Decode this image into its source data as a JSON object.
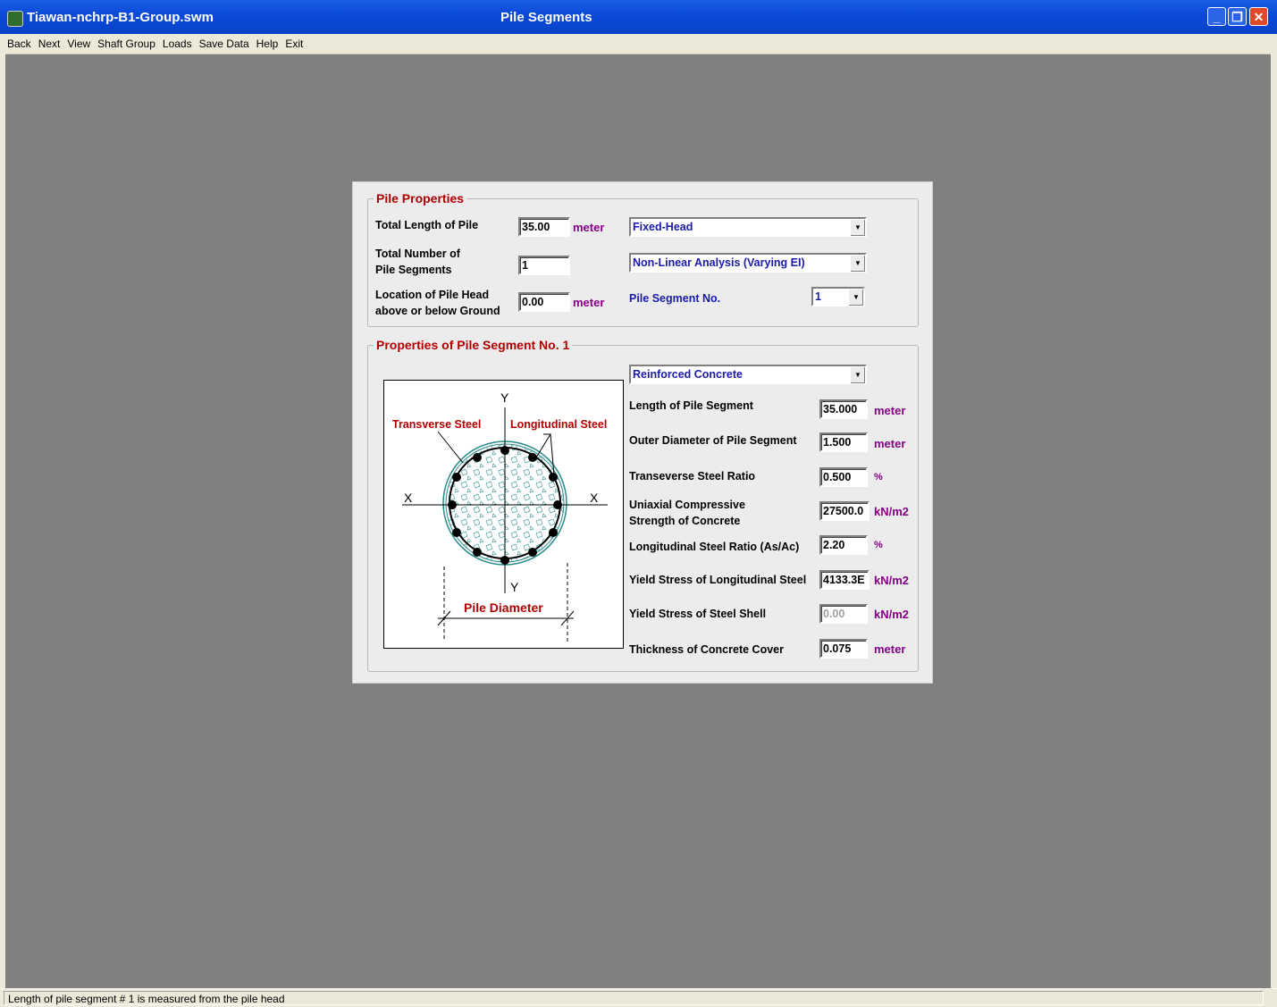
{
  "window": {
    "file_title": "Tiawan-nchrp-B1-Group.swm",
    "screen_title": "Pile Segments",
    "minimize": "_",
    "restore": "❐",
    "close": "✕"
  },
  "menu": [
    "Back",
    "Next",
    "View",
    "Shaft Group",
    "Loads",
    "Save Data",
    "Help",
    "Exit"
  ],
  "pile_properties": {
    "title": "Pile Properties",
    "total_length_label": "Total Length of Pile",
    "total_length_value": "35.00",
    "total_length_unit": "meter",
    "num_segments_label_1": "Total Number of",
    "num_segments_label_2": "Pile Segments",
    "num_segments_value": "1",
    "head_location_label_1": "Location of Pile Head",
    "head_location_label_2": "above or below Ground",
    "head_location_value": "0.00",
    "head_location_unit": "meter",
    "head_condition": "Fixed-Head",
    "analysis_type": "Non-Linear Analysis (Varying EI)",
    "segment_no_label": "Pile Segment No.",
    "segment_no_value": "1"
  },
  "segment": {
    "title": "Properties of Pile Segment No. 1",
    "material": "Reinforced Concrete",
    "diagram": {
      "y_top": "Y",
      "y_bottom": "Y",
      "x_left": "X",
      "x_right": "X",
      "transverse": "Transverse Steel",
      "longitudinal": "Longitudinal Steel",
      "diameter": "Pile Diameter"
    },
    "fields": [
      {
        "label": "Length of Pile Segment",
        "value": "35.000",
        "unit": "meter",
        "disabled": false
      },
      {
        "label": "Outer Diameter of Pile Segment",
        "value": "1.500",
        "unit": "meter",
        "disabled": false
      },
      {
        "label": "Transeverse Steel Ratio",
        "value": "0.500",
        "unit": "%",
        "disabled": false
      },
      {
        "label": "Uniaxial Compressive",
        "label2": "Strength of Concrete",
        "value": "27500.0",
        "unit": "kN/m2",
        "disabled": false
      },
      {
        "label": "Longitudinal Steel Ratio (As/Ac)",
        "value": "2.20",
        "unit": "%",
        "disabled": false
      },
      {
        "label": "Yield Stress of Longitudinal Steel",
        "value": "4133.3E",
        "unit": "kN/m2",
        "disabled": false
      },
      {
        "label": "Yield Stress of Steel Shell",
        "value": "0.00",
        "unit": "kN/m2",
        "disabled": true
      },
      {
        "label": "Thickness of Concrete Cover",
        "value": "0.075",
        "unit": "meter",
        "disabled": false
      }
    ]
  },
  "status": "Length of pile segment # 1 is measured from the pile head",
  "colors": {
    "title_bar": "#0a4ad8",
    "section_title": "#b00000",
    "unit": "#880088",
    "combo_text": "#1a1aa8"
  }
}
